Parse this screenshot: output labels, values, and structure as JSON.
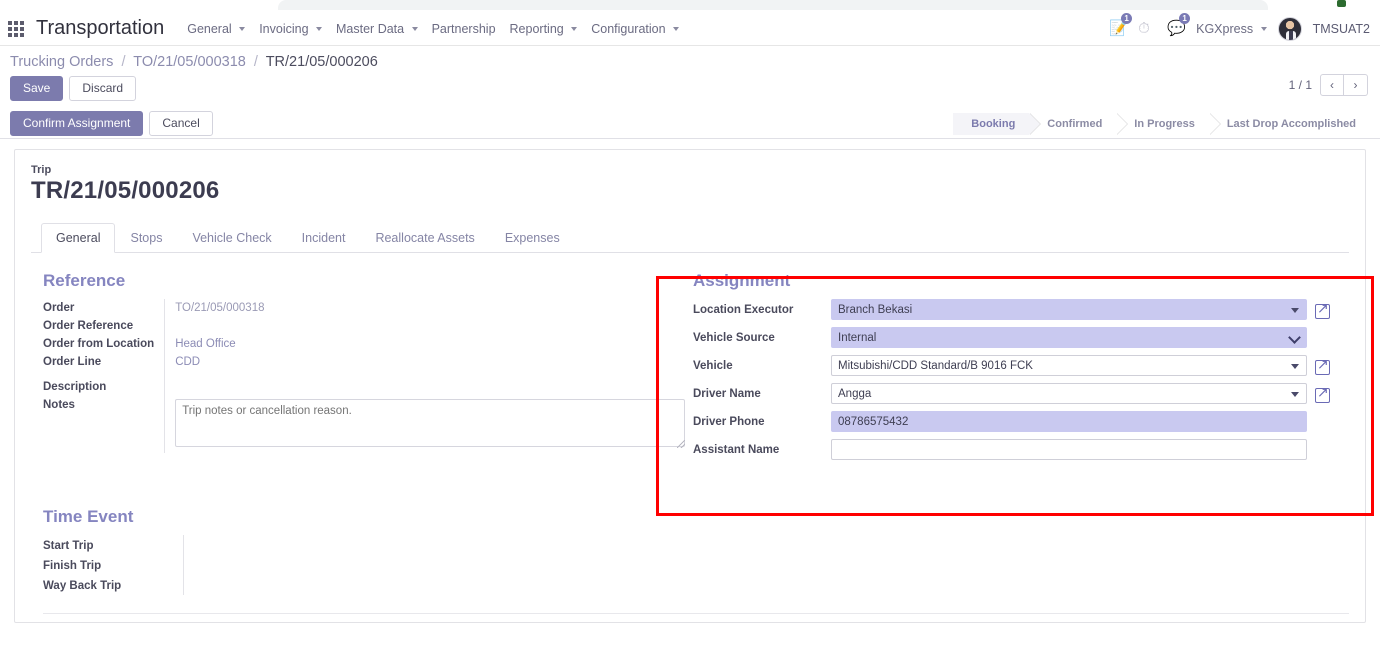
{
  "navbar": {
    "apps_icon": "grid-apps-icon",
    "brand": "Transportation",
    "menus": [
      {
        "label": "General",
        "has_caret": true
      },
      {
        "label": "Invoicing",
        "has_caret": true
      },
      {
        "label": "Master Data",
        "has_caret": true
      },
      {
        "label": "Partnership",
        "has_caret": false
      },
      {
        "label": "Reporting",
        "has_caret": true
      },
      {
        "label": "Configuration",
        "has_caret": true
      }
    ],
    "activities_badge": "1",
    "messages_badge": "1",
    "clock_icon": "clock-icon",
    "edit_icon": "edit-note-icon",
    "chat_icon": "chat-bubbles-icon",
    "company": "KGXpress",
    "user": "TMSUAT2"
  },
  "breadcrumb": {
    "root": "Trucking Orders",
    "parent": "TO/21/05/000318",
    "current": "TR/21/05/000206",
    "separator": "/"
  },
  "toolbar": {
    "save_label": "Save",
    "discard_label": "Discard",
    "confirm_label": "Confirm Assignment",
    "cancel_label": "Cancel"
  },
  "pager": {
    "count": "1 / 1",
    "prev": "‹",
    "next": "›"
  },
  "statusbar": {
    "stages": [
      {
        "label": "Booking",
        "active": true
      },
      {
        "label": "Confirmed",
        "active": false
      },
      {
        "label": "In Progress",
        "active": false
      },
      {
        "label": "Last Drop Accomplished",
        "active": false
      }
    ]
  },
  "record": {
    "label": "Trip",
    "name": "TR/21/05/000206"
  },
  "tabs": [
    {
      "label": "General",
      "active": true
    },
    {
      "label": "Stops",
      "active": false
    },
    {
      "label": "Vehicle Check",
      "active": false
    },
    {
      "label": "Incident",
      "active": false
    },
    {
      "label": "Reallocate Assets",
      "active": false
    },
    {
      "label": "Expenses",
      "active": false
    }
  ],
  "reference": {
    "title": "Reference",
    "order_label": "Order",
    "order_value": "TO/21/05/000318",
    "order_reference_label": "Order Reference",
    "order_reference_value": "",
    "order_from_location_label": "Order from Location",
    "order_from_location_value": "Head Office",
    "order_line_label": "Order Line",
    "order_line_value": "CDD",
    "description_label": "Description",
    "notes_label": "Notes",
    "notes_value": "",
    "notes_placeholder": "Trip notes or cancellation reason."
  },
  "assignment": {
    "title": "Assignment",
    "location_executor_label": "Location Executor",
    "location_executor_value": "Branch Bekasi",
    "vehicle_source_label": "Vehicle Source",
    "vehicle_source_value": "Internal",
    "vehicle_label": "Vehicle",
    "vehicle_value": "Mitsubishi/CDD Standard/B 9016 FCK",
    "driver_name_label": "Driver Name",
    "driver_name_value": "Angga",
    "driver_phone_label": "Driver Phone",
    "driver_phone_value": "08786575432",
    "assistant_name_label": "Assistant Name",
    "assistant_name_value": ""
  },
  "time_event": {
    "title": "Time Event",
    "rows": [
      {
        "label": "Start Trip",
        "value": ""
      },
      {
        "label": "Finish Trip",
        "value": ""
      },
      {
        "label": "Way Back Trip",
        "value": ""
      }
    ]
  },
  "colors": {
    "accent": "#7c7bad",
    "group_title": "#8585c0",
    "field_filled": "#c9c9f0",
    "highlight_box": "#ff0000"
  }
}
